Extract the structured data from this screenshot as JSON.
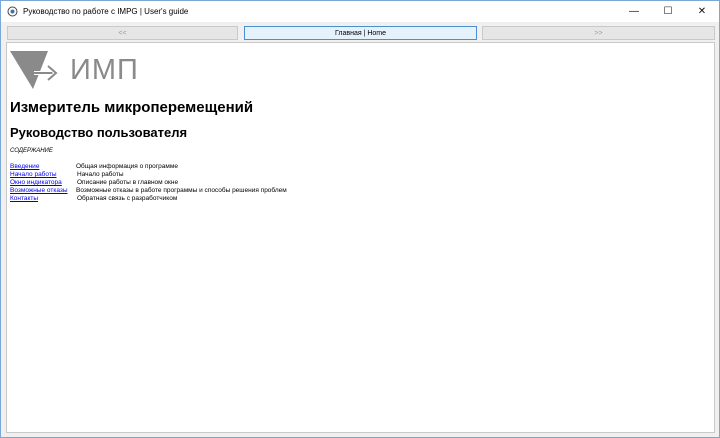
{
  "window": {
    "title": "Руководство по работе с IMPG | User's guide",
    "controls": {
      "minimize": "—",
      "maximize": "☐",
      "close": "✕"
    }
  },
  "nav": {
    "prev": "<<",
    "home": "Главная | Home",
    "next": ">>"
  },
  "logo": {
    "text": "ИМП"
  },
  "page": {
    "heading": "Измеритель микроперемещений",
    "subheading": "Руководство пользователя",
    "contents_label": "СОДЕРЖАНИЕ"
  },
  "toc": [
    {
      "link": "Введение",
      "desc": "Общая информация о программе"
    },
    {
      "link": "Начало работы",
      "desc": "Начало работы"
    },
    {
      "link": "Окно индикатора",
      "desc": "Описание работы в главном окне"
    },
    {
      "link": "Возможные отказы",
      "desc": "Возможные отказы в работе программы и способы решения проблем"
    },
    {
      "link": "Контакты",
      "desc": "Обратная связь с разработчиком"
    }
  ]
}
